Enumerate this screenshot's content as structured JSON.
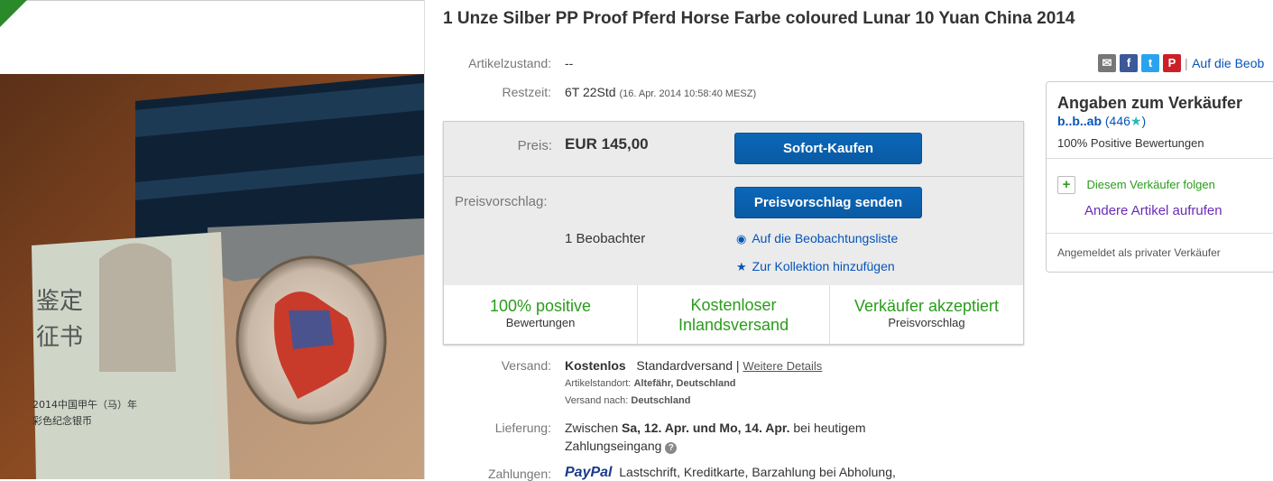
{
  "title": "1 Unze Silber PP Proof Pferd Horse Farbe coloured Lunar 10 Yuan China 2014",
  "condition": {
    "label": "Artikelzustand:",
    "value": "--"
  },
  "time_left": {
    "label": "Restzeit:",
    "value": "6T 22Std",
    "end": "(16. Apr. 2014   10:58:40 MESZ)"
  },
  "price": {
    "label": "Preis:",
    "value": "EUR 145,00",
    "buy_button": "Sofort-Kaufen"
  },
  "offer": {
    "label": "Preisvorschlag:",
    "button": "Preisvorschlag senden",
    "watchers": "1 Beobachter",
    "watch_link": "Auf die Beobachtungsliste",
    "collection_link": "Zur Kollektion hinzufügen"
  },
  "features": [
    {
      "big": "100% positive",
      "small": "Bewertungen"
    },
    {
      "big": "Kostenloser Inlandsversand",
      "small": ""
    },
    {
      "big": "Verkäufer akzeptiert",
      "small": "Preisvorschlag"
    }
  ],
  "shipping": {
    "label": "Versand:",
    "cost": "Kostenlos",
    "type": "Standardversand |",
    "details": "Weitere Details",
    "location_label": "Artikelstandort:",
    "location": "Altefähr, Deutschland",
    "to_label": "Versand nach:",
    "to": "Deutschland"
  },
  "delivery": {
    "label": "Lieferung:",
    "pre": "Zwischen",
    "dates": "Sa, 12. Apr. und Mo, 14. Apr.",
    "post": "bei heutigem",
    "line2": "Zahlungseingang"
  },
  "payments": {
    "label": "Zahlungen:",
    "paypal": "PayPal",
    "methods": "Lastschrift, Kreditkarte, Barzahlung bei Abholung,"
  },
  "share": {
    "link": "Auf die Beob"
  },
  "seller": {
    "heading": "Angaben zum Verkäufer",
    "name": "b..b..ab",
    "score": "(446",
    "score_end": ")",
    "positive": "100% Positive Bewertungen",
    "follow": "Diesem Verkäufer folgen",
    "other": "Andere Artikel aufrufen",
    "note": "Angemeldet als privater Verkäufer"
  },
  "colors": {
    "accent": "#0654ba",
    "green": "#2a9c1b",
    "button": "#0b67b8"
  }
}
